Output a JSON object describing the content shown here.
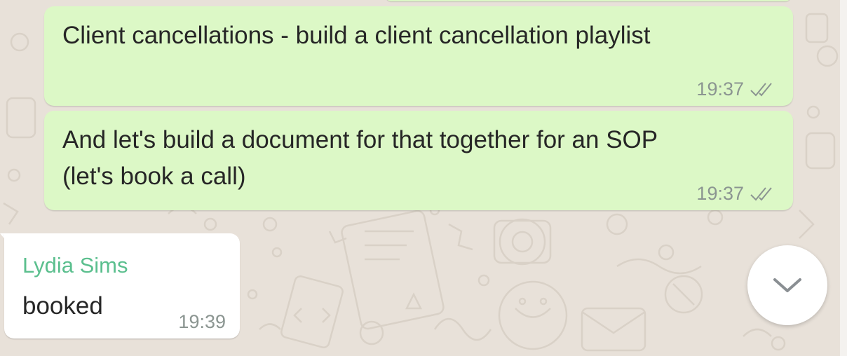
{
  "colors": {
    "outgoing_bubble": "#dcf8c6",
    "incoming_bubble": "#ffffff",
    "sender_name": "#5bbf8e",
    "meta_text": "#8b9591",
    "wallpaper": "#e8e1d9"
  },
  "messages": [
    {
      "direction": "outgoing",
      "text": "Client cancellations - build a client cancellation playlist",
      "time": "19:37",
      "status_icon": "double-check-icon"
    },
    {
      "direction": "outgoing",
      "text": "And let's build a document for that together for an SOP\n(let's book a call)",
      "time": "19:37",
      "status_icon": "double-check-icon"
    },
    {
      "direction": "incoming",
      "sender": "Lydia Sims",
      "text": "booked",
      "time": "19:39"
    }
  ],
  "scroll_button": {
    "icon": "chevron-down-icon"
  }
}
